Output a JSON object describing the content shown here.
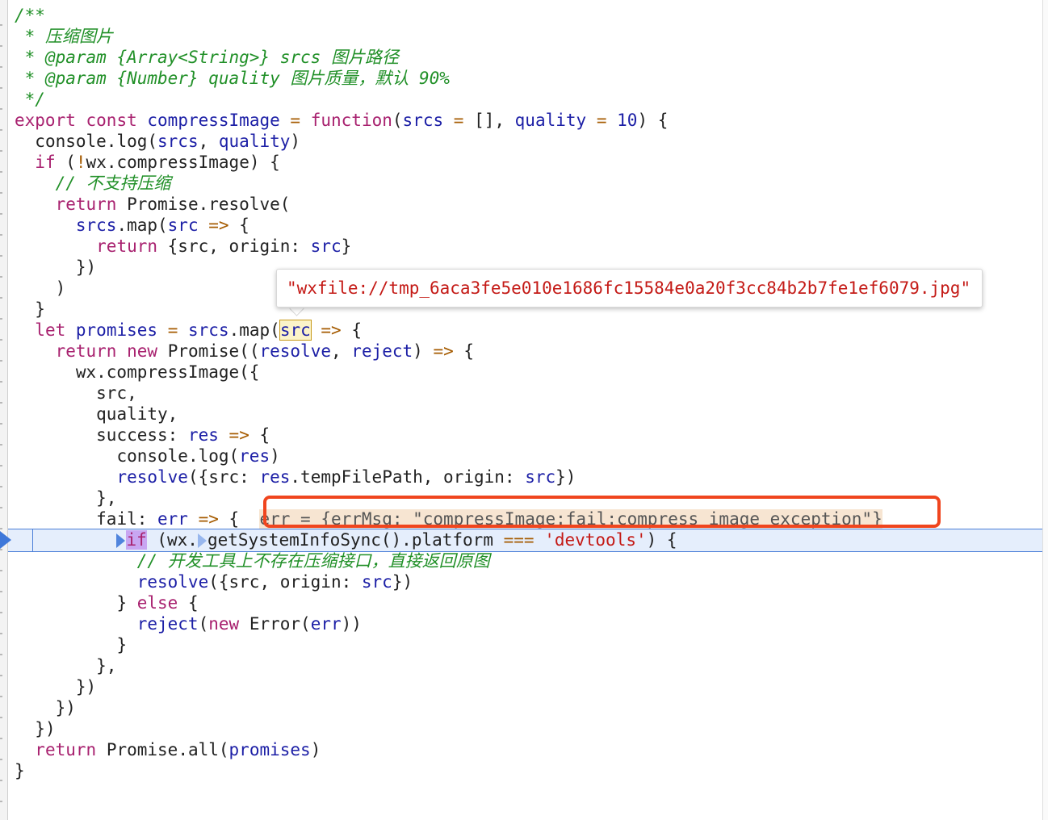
{
  "lines": [
    {
      "indent": "",
      "tokens": [
        {
          "cls": "c-comment",
          "text": "/**"
        }
      ]
    },
    {
      "indent": " ",
      "tokens": [
        {
          "cls": "c-comment",
          "text": "* 压缩图片"
        }
      ]
    },
    {
      "indent": " ",
      "tokens": [
        {
          "cls": "c-comment",
          "text": "* @param {Array<String>} srcs 图片路径"
        }
      ]
    },
    {
      "indent": " ",
      "tokens": [
        {
          "cls": "c-comment",
          "text": "* @param {Number} quality 图片质量，默认 90%"
        }
      ]
    },
    {
      "indent": " ",
      "tokens": [
        {
          "cls": "c-comment",
          "text": "*/"
        }
      ]
    },
    {
      "indent": "",
      "tokens": [
        {
          "cls": "c-kw",
          "text": "export"
        },
        {
          "cls": "c-punc",
          "text": " "
        },
        {
          "cls": "c-kw",
          "text": "const"
        },
        {
          "cls": "c-punc",
          "text": " "
        },
        {
          "cls": "c-fnname",
          "text": "compressImage"
        },
        {
          "cls": "c-punc",
          "text": " "
        },
        {
          "cls": "c-op",
          "text": "="
        },
        {
          "cls": "c-punc",
          "text": " "
        },
        {
          "cls": "c-kw",
          "text": "function"
        },
        {
          "cls": "c-punc",
          "text": "("
        },
        {
          "cls": "c-var",
          "text": "srcs"
        },
        {
          "cls": "c-punc",
          "text": " "
        },
        {
          "cls": "c-op",
          "text": "="
        },
        {
          "cls": "c-punc",
          "text": " [], "
        },
        {
          "cls": "c-var",
          "text": "quality"
        },
        {
          "cls": "c-punc",
          "text": " "
        },
        {
          "cls": "c-op",
          "text": "="
        },
        {
          "cls": "c-punc",
          "text": " "
        },
        {
          "cls": "c-num",
          "text": "10"
        },
        {
          "cls": "c-punc",
          "text": ") {"
        }
      ]
    },
    {
      "indent": "  ",
      "tokens": [
        {
          "cls": "c-fn",
          "text": "console.log("
        },
        {
          "cls": "c-var",
          "text": "srcs"
        },
        {
          "cls": "c-punc",
          "text": ", "
        },
        {
          "cls": "c-var",
          "text": "quality"
        },
        {
          "cls": "c-punc",
          "text": ")"
        }
      ]
    },
    {
      "indent": "  ",
      "tokens": [
        {
          "cls": "c-kw",
          "text": "if"
        },
        {
          "cls": "c-punc",
          "text": " ("
        },
        {
          "cls": "c-op",
          "text": "!"
        },
        {
          "cls": "c-fn",
          "text": "wx.compressImage) {"
        }
      ]
    },
    {
      "indent": "    ",
      "tokens": [
        {
          "cls": "c-comment",
          "text": "// 不支持压缩"
        }
      ]
    },
    {
      "indent": "    ",
      "tokens": [
        {
          "cls": "c-kw",
          "text": "return"
        },
        {
          "cls": "c-punc",
          "text": " "
        },
        {
          "cls": "c-fn",
          "text": "Promise.resolve("
        }
      ]
    },
    {
      "indent": "      ",
      "tokens": [
        {
          "cls": "c-var",
          "text": "srcs"
        },
        {
          "cls": "c-fn",
          "text": ".map("
        },
        {
          "cls": "c-var",
          "text": "src"
        },
        {
          "cls": "c-punc",
          "text": " "
        },
        {
          "cls": "c-op",
          "text": "=>"
        },
        {
          "cls": "c-punc",
          "text": " {"
        }
      ]
    },
    {
      "indent": "        ",
      "tokens": [
        {
          "cls": "c-kw",
          "text": "return"
        },
        {
          "cls": "c-punc",
          "text": " {src, origin: "
        },
        {
          "cls": "c-var",
          "text": "src"
        },
        {
          "cls": "c-punc",
          "text": "}"
        }
      ]
    },
    {
      "indent": "      ",
      "tokens": [
        {
          "cls": "c-punc",
          "text": "})"
        }
      ]
    },
    {
      "indent": "    ",
      "tokens": [
        {
          "cls": "c-punc",
          "text": ")"
        }
      ]
    },
    {
      "indent": "  ",
      "tokens": [
        {
          "cls": "c-punc",
          "text": "}"
        }
      ]
    },
    {
      "indent": "  ",
      "tokens": [
        {
          "cls": "c-kw",
          "text": "let"
        },
        {
          "cls": "c-punc",
          "text": " "
        },
        {
          "cls": "c-var",
          "text": "promises"
        },
        {
          "cls": "c-punc",
          "text": " "
        },
        {
          "cls": "c-op",
          "text": "="
        },
        {
          "cls": "c-punc",
          "text": " "
        },
        {
          "cls": "c-var",
          "text": "srcs"
        },
        {
          "cls": "c-fn",
          "text": ".map("
        },
        {
          "cls": "c-var hover-token",
          "text": "src",
          "name": "hovered-src-token"
        },
        {
          "cls": "c-punc",
          "text": " "
        },
        {
          "cls": "c-op",
          "text": "=>"
        },
        {
          "cls": "c-punc",
          "text": " {"
        }
      ]
    },
    {
      "indent": "    ",
      "tokens": [
        {
          "cls": "c-kw",
          "text": "return"
        },
        {
          "cls": "c-punc",
          "text": " "
        },
        {
          "cls": "c-kw",
          "text": "new"
        },
        {
          "cls": "c-punc",
          "text": " "
        },
        {
          "cls": "c-fn",
          "text": "Promise(("
        },
        {
          "cls": "c-var",
          "text": "resolve"
        },
        {
          "cls": "c-punc",
          "text": ", "
        },
        {
          "cls": "c-var",
          "text": "reject"
        },
        {
          "cls": "c-punc",
          "text": ") "
        },
        {
          "cls": "c-op",
          "text": "=>"
        },
        {
          "cls": "c-punc",
          "text": " {"
        }
      ]
    },
    {
      "indent": "      ",
      "tokens": [
        {
          "cls": "c-fn",
          "text": "wx.compressImage({"
        }
      ]
    },
    {
      "indent": "        ",
      "tokens": [
        {
          "cls": "c-punc",
          "text": "src,"
        }
      ]
    },
    {
      "indent": "        ",
      "tokens": [
        {
          "cls": "c-punc",
          "text": "quality,"
        }
      ]
    },
    {
      "indent": "        ",
      "tokens": [
        {
          "cls": "c-punc",
          "text": "success: "
        },
        {
          "cls": "c-var",
          "text": "res"
        },
        {
          "cls": "c-punc",
          "text": " "
        },
        {
          "cls": "c-op",
          "text": "=>"
        },
        {
          "cls": "c-punc",
          "text": " {"
        }
      ]
    },
    {
      "indent": "          ",
      "tokens": [
        {
          "cls": "c-fn",
          "text": "console.log("
        },
        {
          "cls": "c-var",
          "text": "res"
        },
        {
          "cls": "c-punc",
          "text": ")"
        }
      ]
    },
    {
      "indent": "          ",
      "tokens": [
        {
          "cls": "c-var",
          "text": "resolve"
        },
        {
          "cls": "c-punc",
          "text": "({src: "
        },
        {
          "cls": "c-var",
          "text": "res"
        },
        {
          "cls": "c-fn",
          "text": ".tempFilePath, origin: "
        },
        {
          "cls": "c-var",
          "text": "src"
        },
        {
          "cls": "c-punc",
          "text": "})"
        }
      ]
    },
    {
      "indent": "        ",
      "tokens": [
        {
          "cls": "c-punc",
          "text": "},"
        }
      ]
    },
    {
      "indent": "        ",
      "tokens": [
        {
          "cls": "c-punc",
          "text": "fail: "
        },
        {
          "cls": "c-var",
          "text": "err"
        },
        {
          "cls": "c-punc",
          "text": " "
        },
        {
          "cls": "c-op",
          "text": "=>"
        },
        {
          "cls": "c-punc",
          "text": " {  "
        },
        {
          "cls": "inline-value",
          "text": "err = {errMsg: \"compressImage:fail:compress image exception\"}",
          "name": "inline-value-err"
        }
      ]
    },
    {
      "indent": "          ",
      "exec": true,
      "tokens": [
        {
          "cls": "step-marker",
          "text": "",
          "name": "step-marker-icon"
        },
        {
          "cls": "c-kw pause-kw",
          "text": "if"
        },
        {
          "cls": "c-punc",
          "text": " (wx."
        },
        {
          "cls": "step-marker faint",
          "text": "",
          "name": "step-marker-icon"
        },
        {
          "cls": "c-fn",
          "text": "getSystemInfoSync().platform "
        },
        {
          "cls": "c-op",
          "text": "==="
        },
        {
          "cls": "c-punc",
          "text": " "
        },
        {
          "cls": "c-str",
          "text": "'devtools'"
        },
        {
          "cls": "c-punc",
          "text": ") {"
        }
      ]
    },
    {
      "indent": "            ",
      "tokens": [
        {
          "cls": "c-comment",
          "text": "// 开发工具上不存在压缩接口，直接返回原图"
        }
      ]
    },
    {
      "indent": "            ",
      "tokens": [
        {
          "cls": "c-var",
          "text": "resolve"
        },
        {
          "cls": "c-punc",
          "text": "({src, origin: "
        },
        {
          "cls": "c-var",
          "text": "src"
        },
        {
          "cls": "c-punc",
          "text": "})"
        }
      ]
    },
    {
      "indent": "          ",
      "tokens": [
        {
          "cls": "c-punc",
          "text": "} "
        },
        {
          "cls": "c-kw",
          "text": "else"
        },
        {
          "cls": "c-punc",
          "text": " {"
        }
      ]
    },
    {
      "indent": "            ",
      "tokens": [
        {
          "cls": "c-var",
          "text": "reject"
        },
        {
          "cls": "c-punc",
          "text": "("
        },
        {
          "cls": "c-kw",
          "text": "new"
        },
        {
          "cls": "c-punc",
          "text": " "
        },
        {
          "cls": "c-fn",
          "text": "Error("
        },
        {
          "cls": "c-var",
          "text": "err"
        },
        {
          "cls": "c-punc",
          "text": "))"
        }
      ]
    },
    {
      "indent": "          ",
      "tokens": [
        {
          "cls": "c-punc",
          "text": "}"
        }
      ]
    },
    {
      "indent": "        ",
      "tokens": [
        {
          "cls": "c-punc",
          "text": "},"
        }
      ]
    },
    {
      "indent": "      ",
      "tokens": [
        {
          "cls": "c-punc",
          "text": "})"
        }
      ]
    },
    {
      "indent": "    ",
      "tokens": [
        {
          "cls": "c-punc",
          "text": "})"
        }
      ]
    },
    {
      "indent": "  ",
      "tokens": [
        {
          "cls": "c-punc",
          "text": "})"
        }
      ]
    },
    {
      "indent": "  ",
      "tokens": [
        {
          "cls": "c-kw",
          "text": "return"
        },
        {
          "cls": "c-punc",
          "text": " "
        },
        {
          "cls": "c-fn",
          "text": "Promise.all("
        },
        {
          "cls": "c-var",
          "text": "promises"
        },
        {
          "cls": "c-punc",
          "text": ")"
        }
      ]
    },
    {
      "indent": "",
      "tokens": [
        {
          "cls": "c-punc",
          "text": "}"
        }
      ]
    }
  ],
  "hover_popup": {
    "value": "\"wxfile://tmp_6aca3fe5e010e1686fc15584e0a20f3cc84b2b7fe1ef6079.jpg\""
  },
  "colors": {
    "comment": "#219028",
    "keyword": "#a8216f",
    "variable": "#1c1fa6",
    "string": "#c41a16",
    "operator": "#a55b00",
    "exec_line_bg": "#e5eefc",
    "exec_line_border": "#4a7ed8",
    "annotation_box": "#f0451e",
    "inline_value_bg": "#f7e5d2"
  }
}
